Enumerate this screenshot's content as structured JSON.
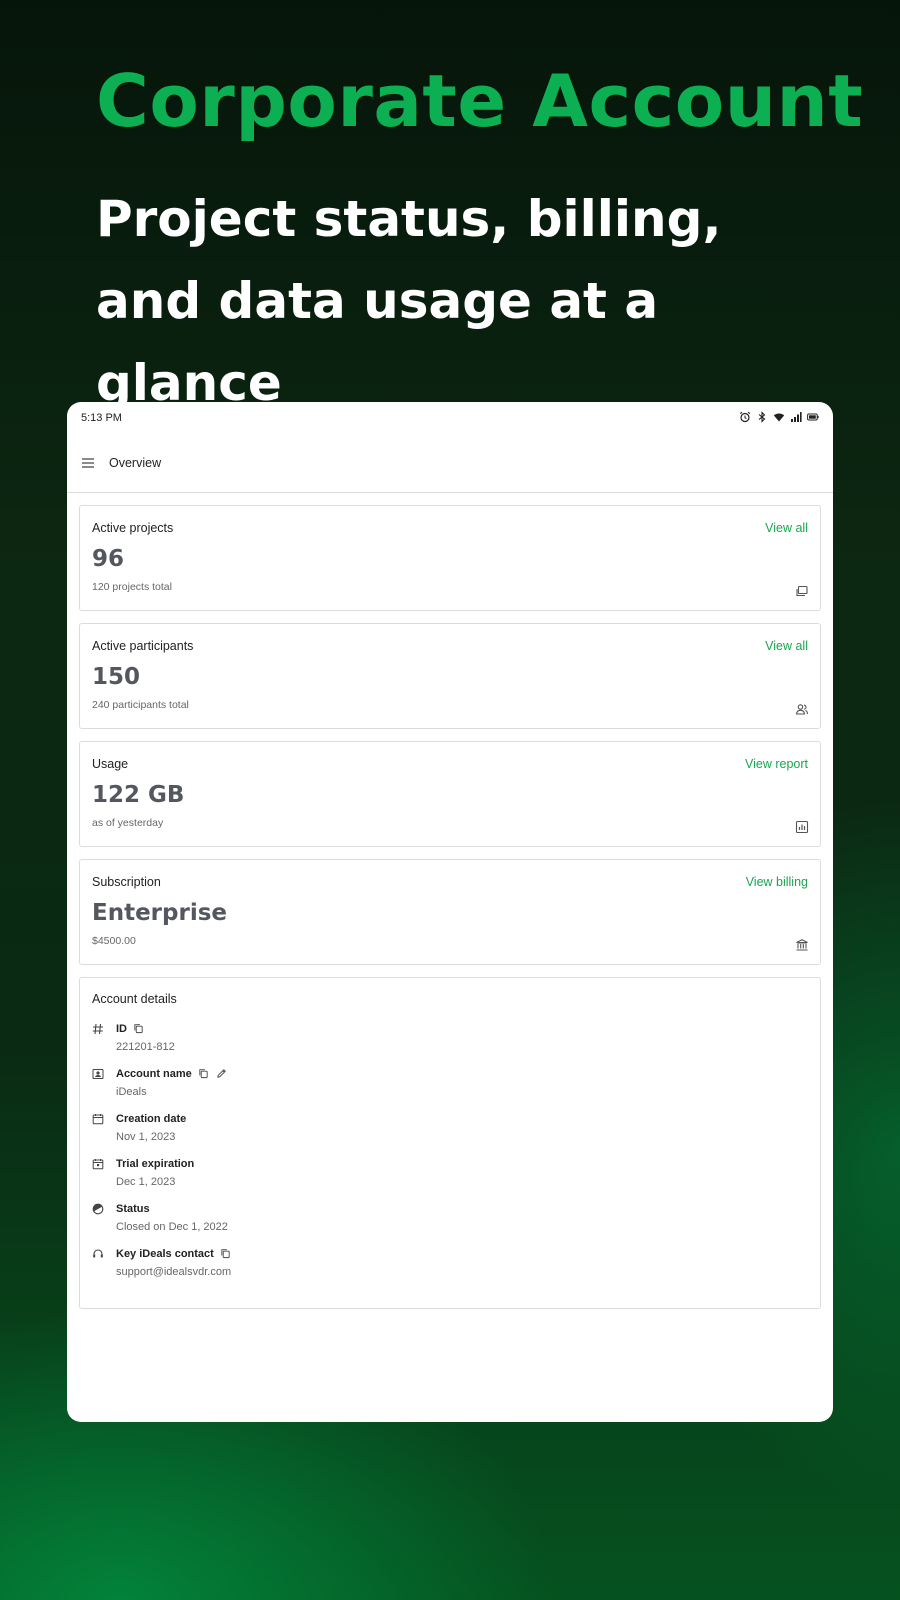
{
  "hero": {
    "title": "Corporate Account",
    "subtitle": "Project status, billing, and data usage at a glance"
  },
  "statusbar": {
    "time": "5:13 PM",
    "icons": [
      "alarm-icon",
      "bluetooth-icon",
      "wifi-icon",
      "signal-icon",
      "battery-icon"
    ]
  },
  "appbar": {
    "title": "Overview"
  },
  "cards": {
    "projects": {
      "label": "Active projects",
      "link": "View all",
      "value": "96",
      "sub": "120 projects total",
      "icon": "folders-icon"
    },
    "participants": {
      "label": "Active participants",
      "link": "View all",
      "value": "150",
      "sub": "240 participants total",
      "icon": "users-icon"
    },
    "usage": {
      "label": "Usage",
      "link": "View report",
      "value": "122 GB",
      "sub": "as of yesterday",
      "icon": "chart-icon"
    },
    "subscription": {
      "label": "Subscription",
      "link": "View billing",
      "value": "Enterprise",
      "sub": "$4500.00",
      "icon": "bank-icon"
    }
  },
  "details": {
    "title": "Account details",
    "id": {
      "label": "ID",
      "value": "221201-812"
    },
    "account_name": {
      "label": "Account name",
      "value": "iDeals"
    },
    "creation_date": {
      "label": "Creation date",
      "value": "Nov 1, 2023"
    },
    "trial_expiration": {
      "label": "Trial expiration",
      "value": "Dec 1, 2023"
    },
    "status": {
      "label": "Status",
      "value": "Closed on Dec 1, 2022"
    },
    "contact": {
      "label": "Key iDeals contact",
      "value": "support@idealsvdr.com"
    }
  },
  "colors": {
    "accent": "#19a64f",
    "hero_title": "#0cb052",
    "value_text": "#545760"
  }
}
